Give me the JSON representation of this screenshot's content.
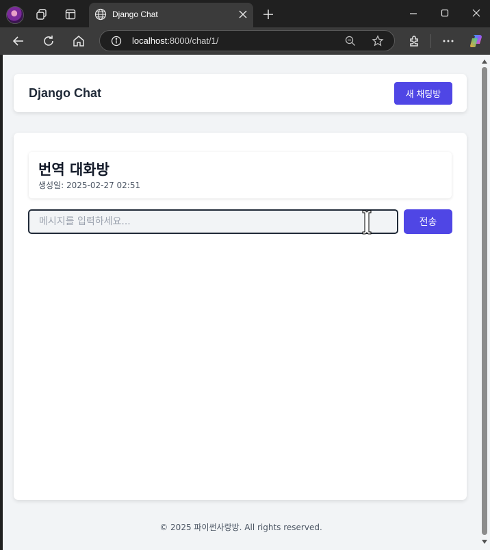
{
  "browser": {
    "tab_title": "Django Chat",
    "url_host": "localhost",
    "url_path": ":8000/chat/1/"
  },
  "header": {
    "brand": "Django Chat",
    "new_room_label": "새 채팅방"
  },
  "room": {
    "title": "번역 대화방",
    "created_at": "생성일: 2025-02-27 02:51"
  },
  "composer": {
    "value": "",
    "placeholder": "메시지를 입력하세요...",
    "send_label": "전송"
  },
  "footer": {
    "text": "© 2025 파이썬사랑방. All rights reserved."
  },
  "colors": {
    "accent": "#4f46e5",
    "page_bg": "#f2f4f6",
    "card_bg": "#ffffff",
    "chrome_dark": "#202020",
    "chrome_mid": "#3b3b3b"
  },
  "icons": [
    "profile-avatar",
    "workspaces-icon",
    "tab-actions-icon",
    "globe-icon",
    "close-icon",
    "plus-icon",
    "minimize-icon",
    "maximize-icon",
    "back-icon",
    "refresh-icon",
    "home-icon",
    "info-icon",
    "zoom-icon",
    "star-icon",
    "extensions-icon",
    "more-icon",
    "copilot-icon",
    "text-cursor-icon"
  ]
}
